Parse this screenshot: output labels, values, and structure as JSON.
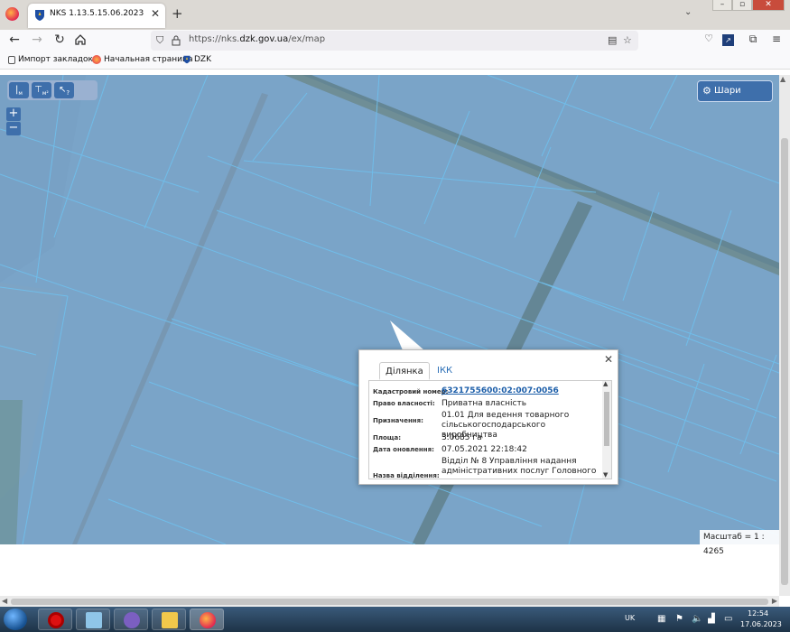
{
  "browser": {
    "tab_title": "NKS 1.13.5.15.06.2023",
    "new_tab": "+",
    "tab_close": "✕",
    "url_prefix": "https://nks.",
    "url_domain": "dzk.gov.ua",
    "url_path": "/ex/map",
    "bookmarks": [
      {
        "label": "Импорт закладок..."
      },
      {
        "label": "Начальная страница"
      },
      {
        "label": "DZK"
      }
    ]
  },
  "map": {
    "layers_label": "Шари",
    "zoom_in": "+",
    "zoom_out": "−",
    "tool_labels": [
      "м",
      "м²",
      "?"
    ],
    "scale_text": "Масштаб = 1 : 4265",
    "colors": {
      "overlay": "#7ba7d4",
      "parcel_lines": "#5fc3f2"
    }
  },
  "popup": {
    "tabs": [
      "Ділянка",
      "ІКК"
    ],
    "close": "✕",
    "fields": [
      {
        "label": "Кадастровий номер:",
        "value": "6321755600:02:007:0056"
      },
      {
        "label": "Право власності:",
        "value": "Приватна власність"
      },
      {
        "label": "Призначення:",
        "value": "01.01 Для ведення товарного сільськогосподарського виробництва"
      },
      {
        "label": "Площа:",
        "value": "3.0685 га"
      },
      {
        "label": "Дата оновлення:",
        "value": "07.05.2021 22:18:42"
      },
      {
        "label": "Назва відділення:",
        "value": "Відділ № 8 Управління надання адміністративних послуг Головного"
      }
    ]
  },
  "taskbar": {
    "lang": "UK",
    "time": "12:54",
    "date": "17.06.2023"
  }
}
